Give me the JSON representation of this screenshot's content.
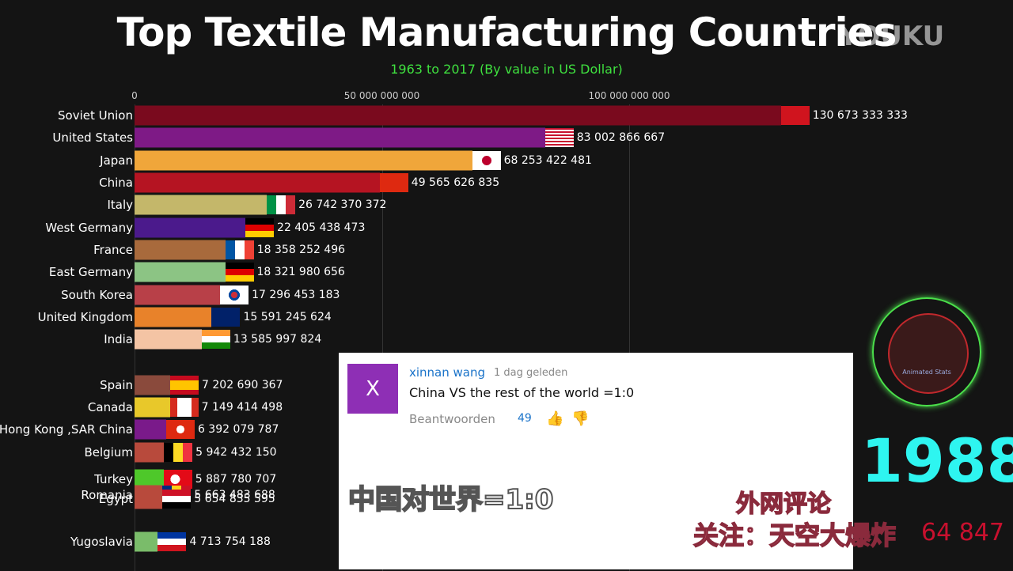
{
  "watermark": "YOUKU",
  "chart_data": {
    "type": "bar",
    "orientation": "horizontal",
    "title": "Top Textile Manufacturing Countries",
    "subtitle": "1963 to 2017 (By value in US Dollar)",
    "year": "1988",
    "x_ticks": [
      "0",
      "50 000 000 000",
      "100 000 000 000"
    ],
    "x_tick_values": [
      0,
      50000000000,
      100000000000
    ],
    "grid": true,
    "bars": [
      {
        "country": "Soviet Union",
        "value": 130673333333,
        "label": "130 673 333 333",
        "color": "#7a0a1e",
        "flag": "soviet-flag"
      },
      {
        "country": "United States",
        "value": 83002866667,
        "label": "83 002 866 667",
        "color": "#7e1a86",
        "flag": "us-flag"
      },
      {
        "country": "Japan",
        "value": 68253422481,
        "label": "68 253 422 481",
        "color": "#f0a63a",
        "flag": "japan-flag"
      },
      {
        "country": "China",
        "value": 49565626835,
        "label": "49 565 626 835",
        "color": "#b51422",
        "flag": "china-flag"
      },
      {
        "country": "Italy",
        "value": 26742370372,
        "label": "26 742 370 372",
        "color": "#c4b76a",
        "flag": "italy-flag"
      },
      {
        "country": "West Germany",
        "value": 22405438473,
        "label": "22 405 438 473",
        "color": "#4b1a8c",
        "flag": "germany-flag"
      },
      {
        "country": "France",
        "value": 18358252496,
        "label": "18 358 252 496",
        "color": "#a86a3c",
        "flag": "france-flag"
      },
      {
        "country": "East Germany",
        "value": 18321980656,
        "label": "18 321 980 656",
        "color": "#8cc484",
        "flag": "east-germany-flag"
      },
      {
        "country": "South Korea",
        "value": 17296453183,
        "label": "17 296 453 183",
        "color": "#b84048",
        "flag": "south-korea-flag"
      },
      {
        "country": "United Kingdom",
        "value": 15591245624,
        "label": "15 591 245 624",
        "color": "#e8822a",
        "flag": "uk-flag"
      },
      {
        "country": "India",
        "value": 13585997824,
        "label": "13 585 997 824",
        "color": "#f4c4a4",
        "flag": "india-flag"
      },
      {
        "country": "Spain",
        "value": 7202690367,
        "label": "7 202 690 367",
        "color": "#8a4a3c",
        "flag": "spain-flag"
      },
      {
        "country": "Canada",
        "value": 7149414498,
        "label": "7 149 414 498",
        "color": "#e8c82a",
        "flag": "canada-flag"
      },
      {
        "country": "Hong Kong ,SAR China",
        "value": 6392079787,
        "label": "6 392 079 787",
        "color": "#7a1a8a",
        "flag": "hong-kong-flag"
      },
      {
        "country": "Belgium",
        "value": 5942432150,
        "label": "5 942 432 150",
        "color": "#b84a3c",
        "flag": "belgium-flag"
      },
      {
        "country": "Turkey",
        "value": 5887780707,
        "label": "5 887 780 707",
        "color": "#4ec82a",
        "flag": "turkey-flag"
      },
      {
        "country": "Romania",
        "value": 5663483688,
        "label": "5 663 483 688",
        "color": "#b84a3c",
        "flag": "romania-flag"
      },
      {
        "country": "Egypt",
        "value": 5654835595,
        "label": "5 654 835 595",
        "color": "#b84a3c",
        "flag": "egypt-flag"
      },
      {
        "country": "Yugoslavia",
        "value": 4713754188,
        "label": "4 713 754 188",
        "color": "#7abc6a",
        "flag": "yugoslavia-flag"
      }
    ],
    "total_partial": "64 847"
  },
  "comment": {
    "avatar": "X",
    "author": "xinnan wang",
    "time": "1 dag geleden",
    "text": "China VS the rest of the world =1:0",
    "reply": "Beantwoorden",
    "likes": "49"
  },
  "captions": {
    "cn_main": "中国对世界=1:0",
    "cn_tag": "外网评论",
    "cn_follow": "关注：天空大爆炸"
  },
  "logo_text": "Animated Stats"
}
